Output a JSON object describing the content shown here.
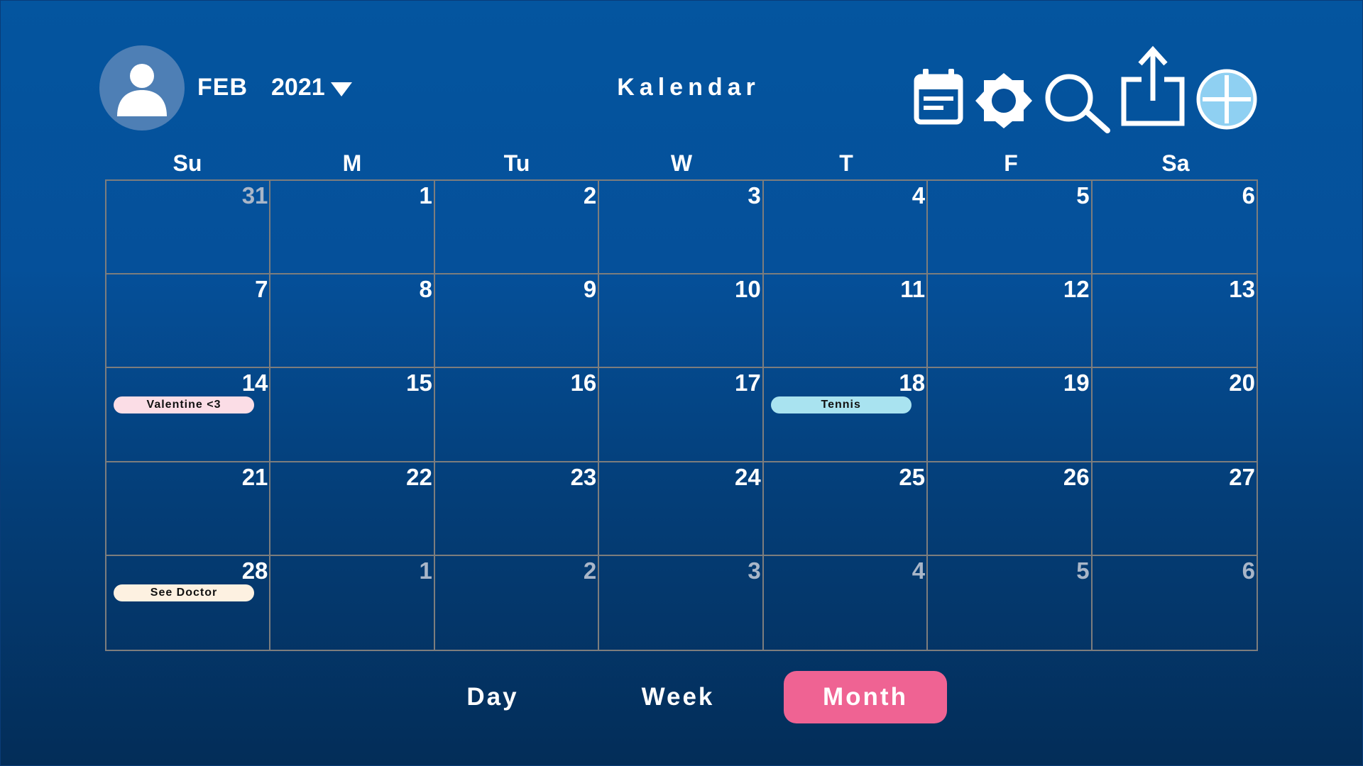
{
  "header": {
    "month": "FEB",
    "year": "2021",
    "title": "Kalendar"
  },
  "toolbar": {
    "icons": [
      "calendar-icon",
      "brightness-icon",
      "search-icon",
      "share-icon",
      "add-icon"
    ],
    "add_color": "#8fd0f2"
  },
  "weekdays": [
    "Su",
    "M",
    "Tu",
    "W",
    "T",
    "F",
    "Sa"
  ],
  "weeks": [
    [
      {
        "day": "31",
        "muted": true
      },
      {
        "day": "1"
      },
      {
        "day": "2"
      },
      {
        "day": "3"
      },
      {
        "day": "4"
      },
      {
        "day": "5"
      },
      {
        "day": "6"
      }
    ],
    [
      {
        "day": "7"
      },
      {
        "day": "8"
      },
      {
        "day": "9"
      },
      {
        "day": "10"
      },
      {
        "day": "11"
      },
      {
        "day": "12"
      },
      {
        "day": "13"
      }
    ],
    [
      {
        "day": "14",
        "event": {
          "label": "Valentine <3",
          "color": "#fbdde6"
        }
      },
      {
        "day": "15"
      },
      {
        "day": "16"
      },
      {
        "day": "17"
      },
      {
        "day": "18",
        "event": {
          "label": "Tennis",
          "color": "#a9e3f0"
        }
      },
      {
        "day": "19"
      },
      {
        "day": "20"
      }
    ],
    [
      {
        "day": "21"
      },
      {
        "day": "22"
      },
      {
        "day": "23"
      },
      {
        "day": "24"
      },
      {
        "day": "25"
      },
      {
        "day": "26"
      },
      {
        "day": "27"
      }
    ],
    [
      {
        "day": "28",
        "event": {
          "label": "See Doctor",
          "color": "#fdf1e1"
        }
      },
      {
        "day": "1",
        "muted": true
      },
      {
        "day": "2",
        "muted": true
      },
      {
        "day": "3",
        "muted": true
      },
      {
        "day": "4",
        "muted": true
      },
      {
        "day": "5",
        "muted": true
      },
      {
        "day": "6",
        "muted": true
      }
    ]
  ],
  "views": {
    "day": "Day",
    "week": "Week",
    "month": "Month",
    "active": "month",
    "active_color": "#ef6393"
  },
  "colors": {
    "background_top": "#04559f",
    "background_bottom": "#032d58",
    "grid_line": "#7d7d7d"
  }
}
